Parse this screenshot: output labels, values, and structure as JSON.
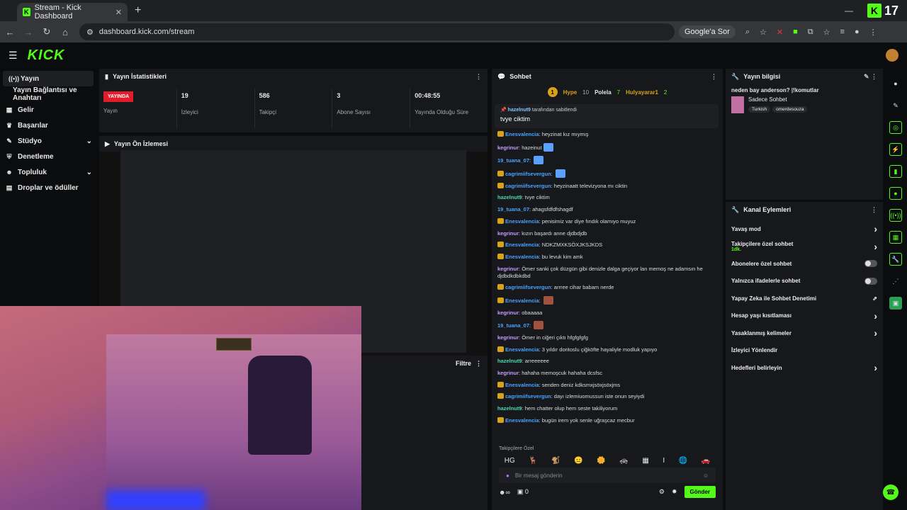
{
  "browser": {
    "tab_title": "Stream - Kick Dashboard",
    "url": "dashboard.kick.com/stream",
    "google_sor": "Google'a Sor",
    "kick_count": "17"
  },
  "app": {
    "logo": "KICK"
  },
  "sidebar": {
    "items": [
      {
        "label": "Yayın",
        "icon": "broadcast-icon"
      },
      {
        "label": "Yayın Bağlantısı ve Anahtarı",
        "icon": ""
      },
      {
        "label": "Gelir",
        "icon": "money-icon"
      },
      {
        "label": "Başarılar",
        "icon": "trophy-icon"
      },
      {
        "label": "Stüdyo",
        "icon": "studio-icon"
      },
      {
        "label": "Denetleme",
        "icon": "shield-icon"
      },
      {
        "label": "Topluluk",
        "icon": "people-icon"
      },
      {
        "label": "Droplar ve ödüller",
        "icon": "gift-icon"
      }
    ]
  },
  "stats": {
    "title": "Yayın İstatistikleri",
    "live": "YAYINDA",
    "items": [
      {
        "value": "",
        "label": "Yayın"
      },
      {
        "value": "19",
        "label": "İzleyici"
      },
      {
        "value": "586",
        "label": "Takipçi"
      },
      {
        "value": "3",
        "label": "Abone Sayısı"
      },
      {
        "value": "00:48:55",
        "label": "Yayında Olduğu Süre"
      }
    ]
  },
  "preview": {
    "title": "Yayın Ön İzlemesi"
  },
  "filtre": {
    "title": "Filtre"
  },
  "chat": {
    "title": "Sohbet",
    "hype": {
      "label": "Hype",
      "level": "1",
      "count": "10",
      "user1": "Polela",
      "user1_count": "7",
      "user2": "Hulyayarar1",
      "user2_count": "2"
    },
    "pinned": {
      "by": "hazelnut9",
      "by_suffix": "tarafından sabitlendi",
      "text": "tvye ciktim"
    },
    "messages": [
      {
        "user": "Enesvalencia",
        "text": "heyzinat kız mıymış",
        "color": "#4aa3ff",
        "badge": true,
        "emote": ""
      },
      {
        "user": "kegrinur",
        "text": "hazeinut",
        "color": "#c89cff",
        "badge": false,
        "emote": "#5aa0ff"
      },
      {
        "user": "19_tuana_07",
        "text": "",
        "color": "#4aa3ff",
        "badge": false,
        "emote": "#5aa0ff"
      },
      {
        "user": "cagrimiifsevergun",
        "text": "",
        "color": "#4aa3ff",
        "badge": true,
        "emote": "#5aa0ff"
      },
      {
        "user": "cagrimiifsevergun",
        "text": "heyzinaatt televizyona mı ciktin",
        "color": "#4aa3ff",
        "badge": true,
        "emote": ""
      },
      {
        "user": "hazelnut9",
        "text": "tvye ciktim",
        "color": "#4adbb0",
        "badge": false,
        "emote": ""
      },
      {
        "user": "19_tuana_07",
        "text": "ahagsfdfdfshagdf",
        "color": "#4aa3ff",
        "badge": false,
        "emote": ""
      },
      {
        "user": "Enesvalencia",
        "text": "penisimiz var diye fındık olamıyo muyuz",
        "color": "#4aa3ff",
        "badge": true,
        "emote": ""
      },
      {
        "user": "kegrinur",
        "text": "kızın başardı anne djdbdjdb",
        "color": "#c89cff",
        "badge": false,
        "emote": ""
      },
      {
        "user": "Enesvalencia",
        "text": "NDKZMXKSÖXJKSJKDS",
        "color": "#4aa3ff",
        "badge": true,
        "emote": ""
      },
      {
        "user": "Enesvalencia",
        "text": "bu levuk kim amk",
        "color": "#4aa3ff",
        "badge": true,
        "emote": ""
      },
      {
        "user": "kegrinur",
        "text": "Ömer sanki çok düzgün gibi denizle dalga geçiyor lan memoş ne adamsın he djdbdkdbkdbd",
        "color": "#c89cff",
        "badge": false,
        "emote": ""
      },
      {
        "user": "cagrimiifsevergun",
        "text": "arrree cihar babam nerde",
        "color": "#4aa3ff",
        "badge": true,
        "emote": ""
      },
      {
        "user": "Enesvalencia",
        "text": "",
        "color": "#4aa3ff",
        "badge": true,
        "emote": "#a0523d"
      },
      {
        "user": "kegrinur",
        "text": "obaaaaa",
        "color": "#c89cff",
        "badge": false,
        "emote": ""
      },
      {
        "user": "19_tuana_07",
        "text": "",
        "color": "#4aa3ff",
        "badge": false,
        "emote": "#a0523d"
      },
      {
        "user": "kegrinur",
        "text": "Ömer in ciğeri çıktı hfgfgfgfg",
        "color": "#c89cff",
        "badge": false,
        "emote": ""
      },
      {
        "user": "Enesvalencia",
        "text": "3 yıldır doritoslu çiğköfte hayaliyle modluk yapıyo",
        "color": "#4aa3ff",
        "badge": true,
        "emote": ""
      },
      {
        "user": "hazelnut9",
        "text": "arreeeeee",
        "color": "#4adbb0",
        "badge": false,
        "emote": ""
      },
      {
        "user": "kegrinur",
        "text": "hahaha memoşcuk hahaha dcsfsc",
        "color": "#c89cff",
        "badge": false,
        "emote": ""
      },
      {
        "user": "Enesvalencia",
        "text": "senden deniz kdksmxjsöxjsöxjms",
        "color": "#4aa3ff",
        "badge": true,
        "emote": ""
      },
      {
        "user": "cagrimiifsevergun",
        "text": "dayı izlemiuomussun iste onun seyiydi",
        "color": "#4aa3ff",
        "badge": true,
        "emote": ""
      },
      {
        "user": "hazelnut9",
        "text": "hem chatter olup hem seste takiliyorum",
        "color": "#4adbb0",
        "badge": false,
        "emote": ""
      },
      {
        "user": "Enesvalencia",
        "text": "bugün irem yok senle uğraşcaz mecbur",
        "color": "#4aa3ff",
        "badge": true,
        "emote": ""
      }
    ],
    "followers_label": "Takipçilere Özel",
    "input_placeholder": "Bir mesaj gönderin",
    "viewer_count": "0",
    "send_label": "Gönder"
  },
  "info": {
    "title": "Yayın bilgisi",
    "stream_title": "neden bay anderson? |!komutlar",
    "category": "Sadece Sohbet",
    "tags": [
      "Turkish",
      "omerdesouza"
    ]
  },
  "actions": {
    "title": "Kanal Eylemleri",
    "items": [
      {
        "label": "Yavaş mod",
        "sub": "",
        "type": "arrow"
      },
      {
        "label": "Takipçilere özel sohbet",
        "sub": "1dk.",
        "type": "arrow"
      },
      {
        "label": "Abonelere özel sohbet",
        "sub": "",
        "type": "toggle"
      },
      {
        "label": "Yalnızca ifadelerle sohbet",
        "sub": "",
        "type": "toggle"
      },
      {
        "label": "Yapay Zeka ile Sohbet Denetimi",
        "sub": "",
        "type": "external"
      },
      {
        "label": "Hesap yaşı kısıtlaması",
        "sub": "",
        "type": "arrow"
      },
      {
        "label": "Yasaklanmış kelimeler",
        "sub": "",
        "type": "arrow"
      },
      {
        "label": "İzleyici Yönlendir",
        "sub": "",
        "type": "none"
      },
      {
        "label": "Hedefleri belirleyin",
        "sub": "",
        "type": "arrow"
      }
    ]
  }
}
